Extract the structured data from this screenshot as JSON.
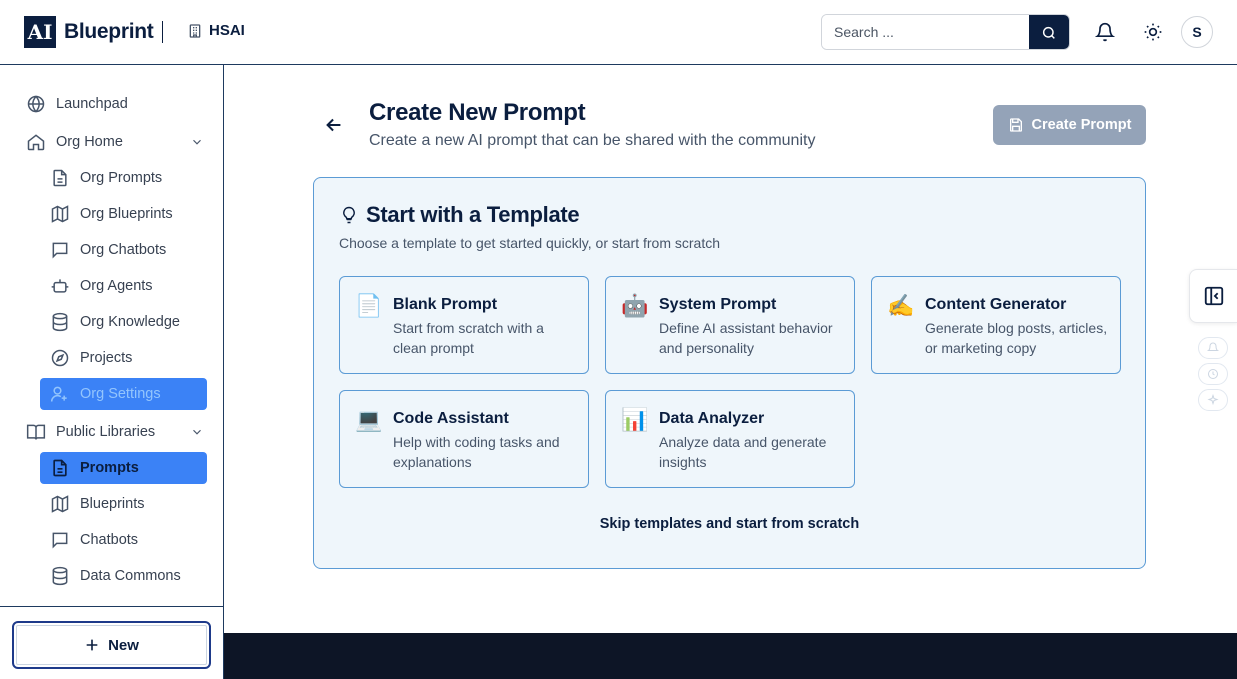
{
  "header": {
    "logo_mark": "AI",
    "logo_text": "Blueprint",
    "org_name": "HSAI",
    "search_placeholder": "Search ...",
    "avatar_initial": "S"
  },
  "sidebar": {
    "items": [
      {
        "label": "Launchpad",
        "icon": "globe-icon"
      },
      {
        "label": "Org Home",
        "icon": "home-icon",
        "expanded": true
      },
      {
        "label": "Org Prompts",
        "icon": "document-icon"
      },
      {
        "label": "Org Blueprints",
        "icon": "map-icon"
      },
      {
        "label": "Org Chatbots",
        "icon": "chat-icon"
      },
      {
        "label": "Org Agents",
        "icon": "robot-icon"
      },
      {
        "label": "Org Knowledge",
        "icon": "database-icon"
      },
      {
        "label": "Projects",
        "icon": "compass-icon"
      },
      {
        "label": "Org Settings",
        "icon": "user-settings-icon"
      },
      {
        "label": "Public Libraries",
        "icon": "book-icon",
        "expanded": true
      },
      {
        "label": "Prompts",
        "icon": "document-icon",
        "active": true
      },
      {
        "label": "Blueprints",
        "icon": "map-icon"
      },
      {
        "label": "Chatbots",
        "icon": "chat-icon"
      },
      {
        "label": "Data Commons",
        "icon": "database-icon"
      }
    ],
    "new_button": "New"
  },
  "main": {
    "title": "Create New Prompt",
    "subtitle": "Create a new AI prompt that can be shared with the community",
    "create_button": "Create Prompt",
    "templates": {
      "heading": "Start with a Template",
      "description": "Choose a template to get started quickly, or start from scratch",
      "cards": [
        {
          "emoji": "📄",
          "title": "Blank Prompt",
          "desc": "Start from scratch with a clean prompt"
        },
        {
          "emoji": "🤖",
          "title": "System Prompt",
          "desc": "Define AI assistant behavior and personality"
        },
        {
          "emoji": "✍️",
          "title": "Content Generator",
          "desc": "Generate blog posts, articles, or marketing copy"
        },
        {
          "emoji": "💻",
          "title": "Code Assistant",
          "desc": "Help with coding tasks and explanations"
        },
        {
          "emoji": "📊",
          "title": "Data Analyzer",
          "desc": "Analyze data and generate insights"
        }
      ],
      "skip_link": "Skip templates and start from scratch"
    }
  },
  "colors": {
    "brand_navy": "#0b1e3f",
    "active_blue": "#3b82f6",
    "panel_bg": "#eff6fb",
    "panel_border": "#5b9bd5",
    "disabled_button": "#94a3b8"
  }
}
